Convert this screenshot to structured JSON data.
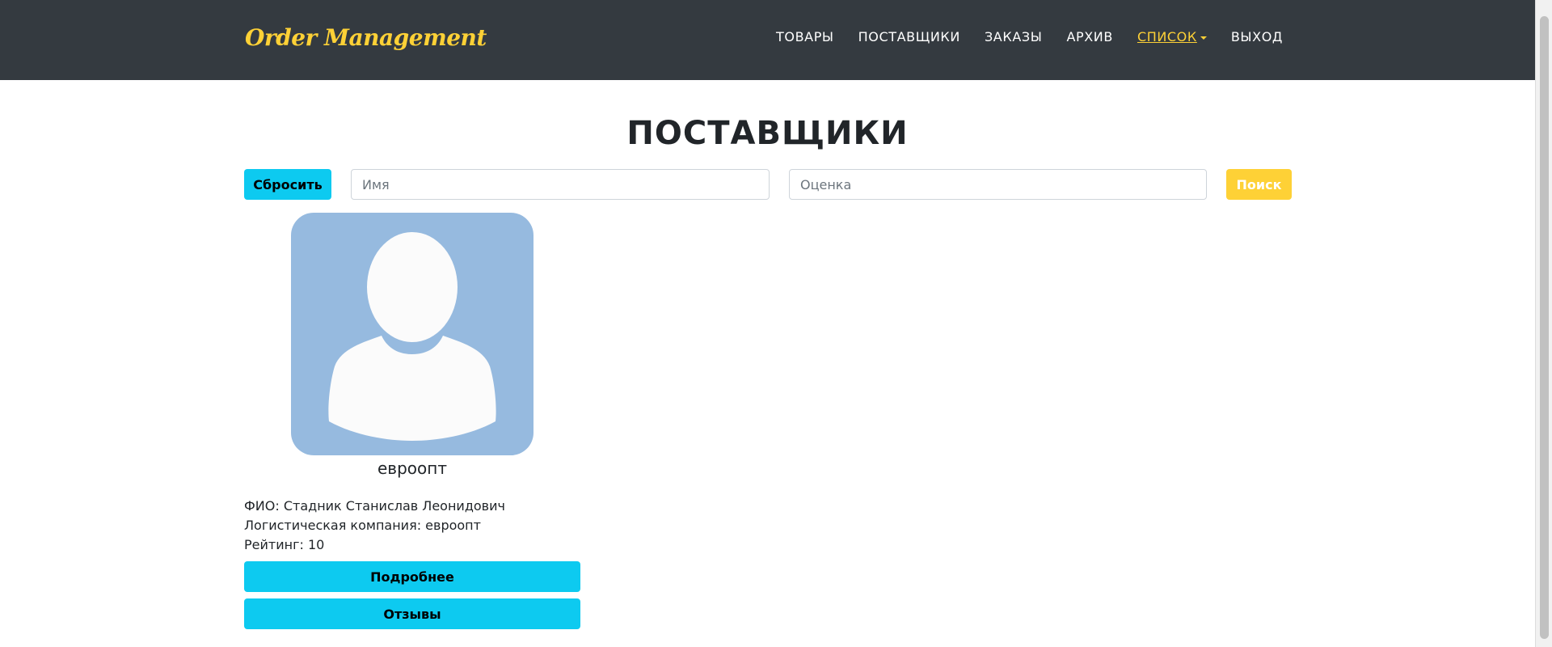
{
  "navbar": {
    "brand": "Order Management",
    "items": [
      {
        "label": "ТОВАРЫ"
      },
      {
        "label": "ПОСТАВЩИКИ"
      },
      {
        "label": "ЗАКАЗЫ"
      },
      {
        "label": "АРХИВ"
      },
      {
        "label": "СПИСОК",
        "active": true,
        "dropdown": true
      },
      {
        "label": "ВЫХОД"
      }
    ]
  },
  "page": {
    "title": "ПОСТАВЩИКИ"
  },
  "search": {
    "reset_label": "Сбросить",
    "name_placeholder": "Имя",
    "rating_placeholder": "Оценка",
    "search_label": "Поиск"
  },
  "supplier": {
    "name": "евроопт",
    "fio_label": "ФИО:",
    "fio_value": "Стадник Станислав Леонидович",
    "company_label": "Логистическая компания:",
    "company_value": "евроопт",
    "rating_label": "Рейтинг:",
    "rating_value": "10",
    "details_label": "Подробнее",
    "reviews_label": "Отзывы",
    "avatar_icon": "user-silhouette-icon"
  },
  "colors": {
    "navbar_bg": "#343a40",
    "accent_yellow": "#fed136",
    "accent_cyan": "#0dcaf0",
    "avatar_bg": "#96badf"
  }
}
